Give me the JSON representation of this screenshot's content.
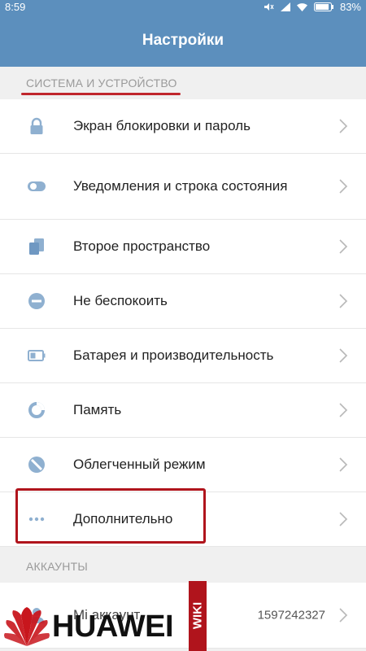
{
  "status_bar": {
    "time": "8:59",
    "battery": "83%"
  },
  "header": {
    "title": "Настройки"
  },
  "section_system": {
    "title": "СИСТЕМА И УСТРОЙСТВО",
    "items": [
      {
        "label": "Экран блокировки и пароль",
        "icon": "lock-icon"
      },
      {
        "label": "Уведомления и строка состояния",
        "icon": "toggle-icon"
      },
      {
        "label": "Второе пространство",
        "icon": "second-space-icon"
      },
      {
        "label": "Не беспокоить",
        "icon": "do-not-disturb-icon"
      },
      {
        "label": "Батарея и производительность",
        "icon": "battery-icon"
      },
      {
        "label": "Память",
        "icon": "storage-icon"
      },
      {
        "label": "Облегченный режим",
        "icon": "lite-mode-icon"
      },
      {
        "label": "Дополнительно",
        "icon": "more-icon"
      }
    ]
  },
  "section_accounts": {
    "title": "АККАУНТЫ",
    "items": [
      {
        "label": "Mi аккаунт",
        "value": "1597242327",
        "icon": "mi-account-icon"
      }
    ]
  },
  "watermark": {
    "brand": "HUAWEI",
    "tag": "WIKI"
  },
  "colors": {
    "accent": "#5c8fbd",
    "icon": "#8fb0d0",
    "annotation_red": "#c0262c"
  }
}
